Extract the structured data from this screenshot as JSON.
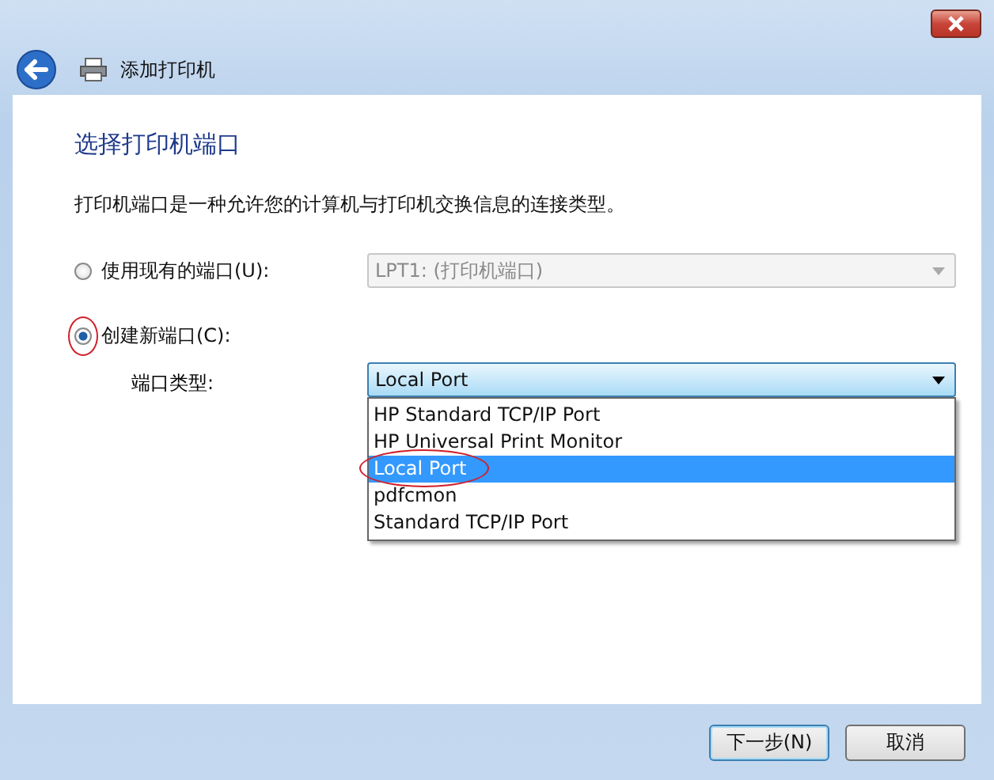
{
  "window": {
    "title": "添加打印机"
  },
  "heading": "选择打印机端口",
  "description": "打印机端口是一种允许您的计算机与打印机交换信息的连接类型。",
  "options": [
    {
      "label": "使用现有的端口(U):",
      "selected": false,
      "circled": false,
      "combo": {
        "value": "LPT1: (打印机端口)",
        "disabled": true
      }
    },
    {
      "label": "创建新端口(C):",
      "selected": true,
      "circled": true
    }
  ],
  "port_type": {
    "label": "端口类型:",
    "value": "Local Port",
    "expanded": true,
    "items": [
      {
        "label": "HP Standard TCP/IP Port",
        "selected": false,
        "circled": false
      },
      {
        "label": "HP Universal Print Monitor",
        "selected": false,
        "circled": false
      },
      {
        "label": "Local Port",
        "selected": true,
        "circled": true
      },
      {
        "label": "pdfcmon",
        "selected": false,
        "circled": false
      },
      {
        "label": "Standard TCP/IP Port",
        "selected": false,
        "circled": false
      }
    ]
  },
  "buttons": [
    "下一步(N)",
    "取消"
  ]
}
